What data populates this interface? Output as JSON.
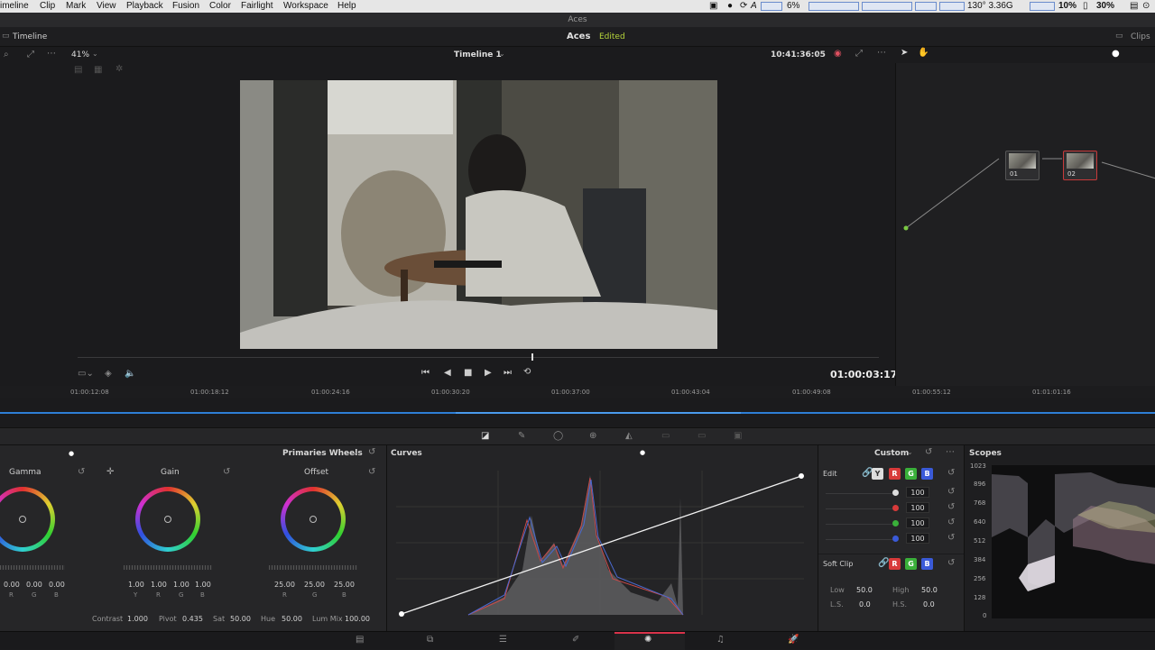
{
  "menubar": {
    "items": [
      "imeline",
      "Clip",
      "Mark",
      "View",
      "Playback",
      "Fusion",
      "Color",
      "Fairlight",
      "Workspace",
      "Help"
    ],
    "status": {
      "battery": "6%",
      "temp": "130° 3.36G",
      "cpu": "10%",
      "mem": "30%",
      "a_label": "A"
    }
  },
  "window": {
    "title": "Aces"
  },
  "toolbar": {
    "timeline_label": "Timeline",
    "project": "Aces",
    "status": "Edited",
    "clips_label": "Clips"
  },
  "viewer": {
    "zoom": "41%",
    "timeline_name": "Timeline 1",
    "timecode_top": "10:41:36:05",
    "timecode": "01:00:03:17"
  },
  "nodes": [
    {
      "label": "01"
    },
    {
      "label": "02"
    }
  ],
  "ruler": [
    "01:00:12:08",
    "01:00:18:12",
    "01:00:24:16",
    "01:00:30:20",
    "01:00:37:00",
    "01:00:43:04",
    "01:00:49:08",
    "01:00:55:12",
    "01:01:01:16"
  ],
  "wheels": {
    "mode": "Primaries Wheels",
    "items": [
      {
        "name": "Gamma",
        "values": [
          "0.00",
          "0.00",
          "0.00"
        ],
        "subs": [
          "R",
          "G",
          "B"
        ]
      },
      {
        "name": "Gain",
        "values": [
          "1.00",
          "1.00",
          "1.00",
          "1.00"
        ],
        "subs": [
          "Y",
          "R",
          "G",
          "B"
        ]
      },
      {
        "name": "Offset",
        "values": [
          "25.00",
          "25.00",
          "25.00"
        ],
        "subs": [
          "R",
          "G",
          "B"
        ]
      }
    ],
    "params": [
      {
        "label": "Contrast",
        "value": "1.000"
      },
      {
        "label": "Pivot",
        "value": "0.435"
      },
      {
        "label": "Sat",
        "value": "50.00"
      },
      {
        "label": "Hue",
        "value": "50.00"
      },
      {
        "label": "Lum Mix",
        "value": "100.00"
      }
    ]
  },
  "curves": {
    "title": "Curves"
  },
  "custom": {
    "title": "Custom",
    "edit_label": "Edit",
    "channels": [
      "Y",
      "R",
      "G",
      "B"
    ],
    "values": [
      "100",
      "100",
      "100",
      "100"
    ],
    "softclip_label": "Soft Clip",
    "low_label": "Low",
    "low": "50.0",
    "high_label": "High",
    "high": "50.0",
    "ls_label": "L.S.",
    "ls": "0.0",
    "hs_label": "H.S.",
    "hs": "0.0"
  },
  "scopes": {
    "title": "Scopes",
    "axis": [
      "1023",
      "896",
      "768",
      "640",
      "512",
      "384",
      "256",
      "128",
      "0"
    ]
  },
  "colors": {
    "accent": "#2e7fd6",
    "edited": "#b5d43a",
    "active_page": "#d8334a"
  }
}
